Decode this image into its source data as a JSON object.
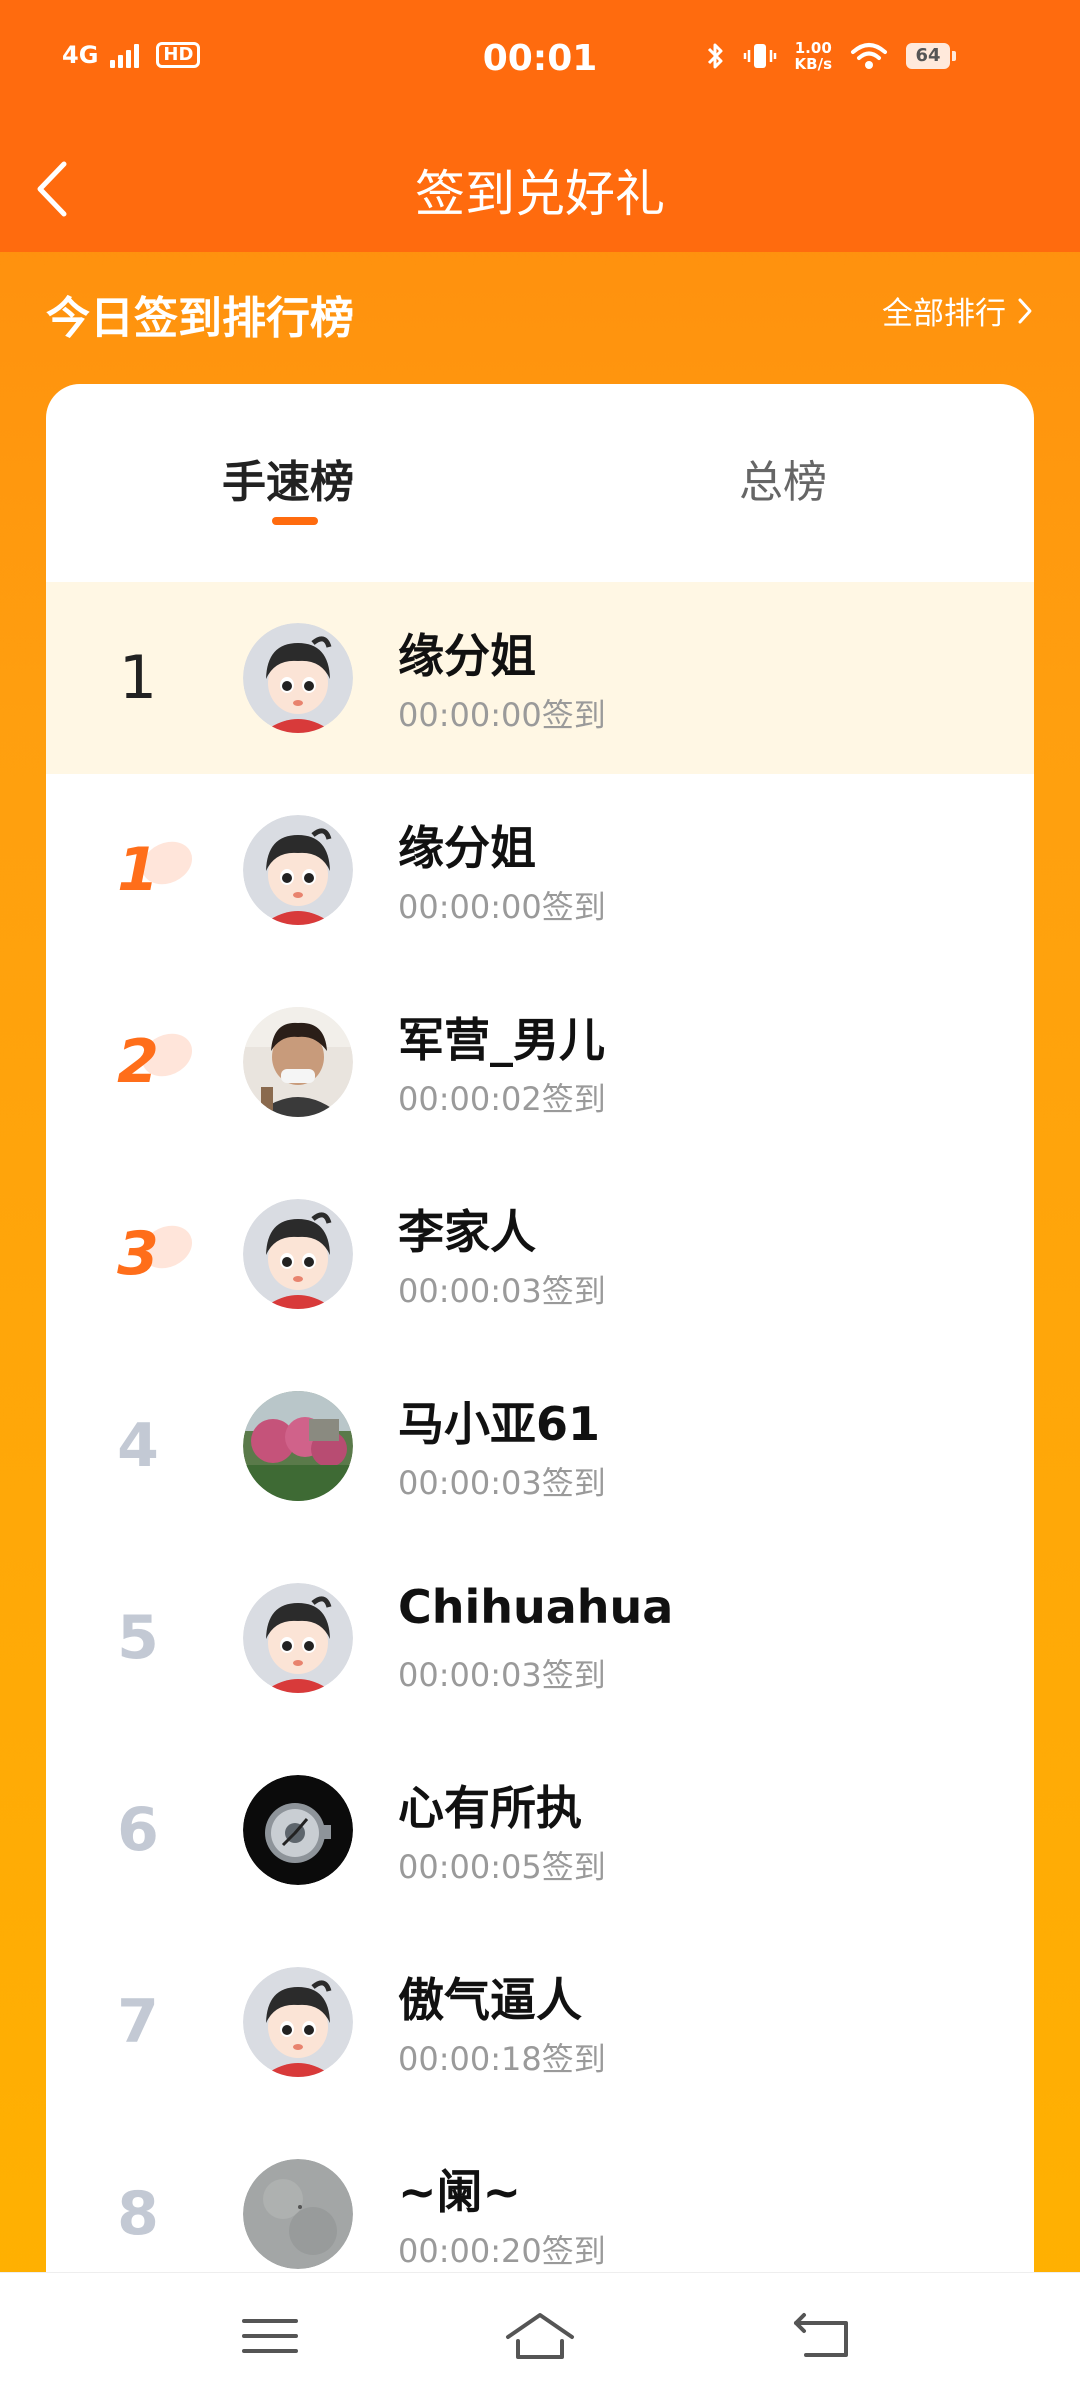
{
  "status_bar": {
    "network": "4G",
    "hd": "HD",
    "time": "00:01",
    "speed_value": "1.00",
    "speed_unit": "KB/s",
    "battery": "64"
  },
  "header": {
    "title": "签到兑好礼"
  },
  "section": {
    "title": "今日签到排行榜",
    "all_rank_label": "全部排行"
  },
  "tabs": [
    {
      "label": "手速榜",
      "active": true
    },
    {
      "label": "总榜",
      "active": false
    }
  ],
  "my_row": {
    "rank": "1",
    "name": "缘分姐",
    "time": "00:00:00签到",
    "avatar": "cartoon-avatar"
  },
  "rows": [
    {
      "rank": "1",
      "name": "缘分姐",
      "time": "00:00:00签到",
      "avatar": "cartoon-avatar"
    },
    {
      "rank": "2",
      "name": "军营_男儿",
      "time": "00:00:02签到",
      "avatar": "photo-avatar-person"
    },
    {
      "rank": "3",
      "name": "李家人",
      "time": "00:00:03签到",
      "avatar": "cartoon-avatar"
    },
    {
      "rank": "4",
      "name": "马小亚61",
      "time": "00:00:03签到",
      "avatar": "photo-avatar-garden"
    },
    {
      "rank": "5",
      "name": "Chihuahua",
      "time": "00:00:03签到",
      "avatar": "cartoon-avatar"
    },
    {
      "rank": "6",
      "name": "心有所执",
      "time": "00:00:05签到",
      "avatar": "photo-avatar-watch"
    },
    {
      "rank": "7",
      "name": "傲气逼人",
      "time": "00:00:18签到",
      "avatar": "cartoon-avatar"
    },
    {
      "rank": "8",
      "name": "~阑~",
      "time": "00:00:20签到",
      "avatar": "photo-avatar-gray"
    }
  ],
  "colors": {
    "accent": "#FF6B0E",
    "medal": "#FF6E1A",
    "highlight_row": "#FFF7E4",
    "rank_gray": "#C3C9D4"
  },
  "icons": {
    "back": "chevron-left-icon",
    "all_rank": "chevron-right-icon",
    "nav_menu": "menu-icon",
    "nav_home": "home-icon",
    "nav_back": "return-icon"
  }
}
